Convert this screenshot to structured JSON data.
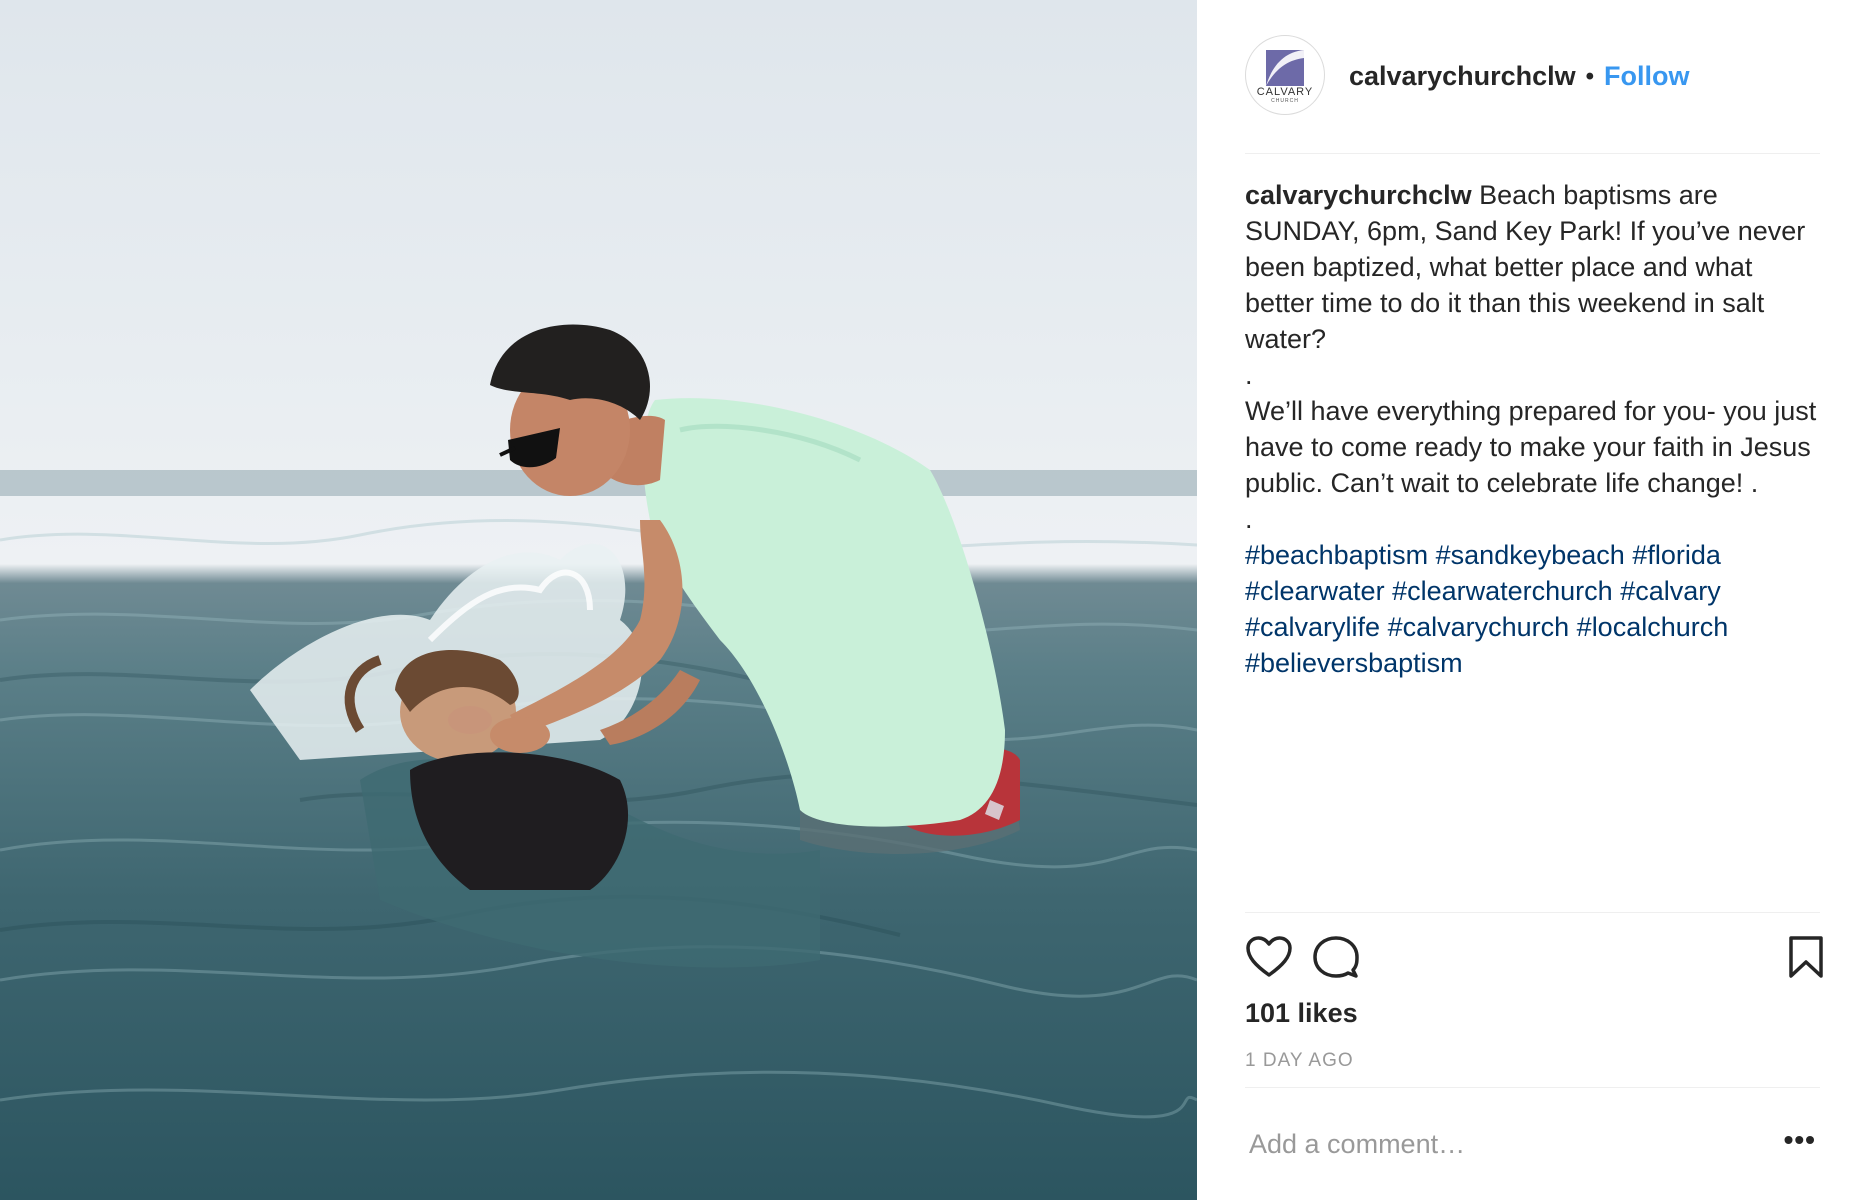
{
  "post": {
    "username": "calvarychurchclw",
    "follow_label": "Follow",
    "separator": "•",
    "avatar": {
      "logo_text": "CALVARY",
      "logo_subtext": "CHURCH"
    },
    "caption": {
      "username": "calvarychurchclw",
      "paragraph1": "Beach baptisms are SUNDAY, 6pm, Sand Key Park! If you’ve never been baptized, what better place and what better time to do it than this weekend in salt water?",
      "dot1": ".",
      "paragraph2": "We’ll have everything prepared for you- you just have to come ready to make your faith in Jesus public. Can’t wait to celebrate life change! .",
      "dot2": ".",
      "hashtags": [
        "#beachbaptism",
        "#sandkeybeach",
        "#florida",
        "#clearwater",
        "#clearwaterchurch",
        "#calvary",
        "#calvarylife",
        "#calvarychurch",
        "#localchurch",
        "#believersbaptism"
      ]
    },
    "actions": {
      "like_icon": "heart-outline-icon",
      "comment_icon": "speech-bubble-icon",
      "save_icon": "bookmark-outline-icon"
    },
    "likes_text": "101 likes",
    "timestamp": "1 DAY AGO",
    "comment": {
      "placeholder": "Add a comment…",
      "value": "",
      "more_label": "•••"
    },
    "colors": {
      "link_blue": "#3897f0",
      "hashtag_blue": "#003569",
      "text": "#262626",
      "muted": "#999999",
      "divider": "#efefef",
      "logo_purple": "#6d6aa8"
    }
  }
}
